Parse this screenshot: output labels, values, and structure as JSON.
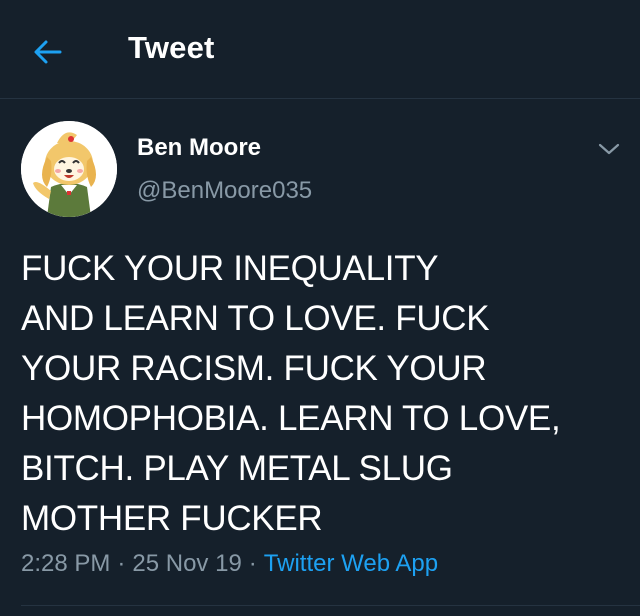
{
  "header": {
    "back_icon": "arrow-left-icon",
    "title": "Tweet"
  },
  "author": {
    "avatar_icon": "avatar-isabelle",
    "name": "Ben Moore",
    "handle": "@BenMoore035"
  },
  "tweet": {
    "lines": [
      "FUCK YOUR INEQUALITY",
      "AND LEARN TO LOVE. FUCK",
      "YOUR RACISM. FUCK YOUR",
      "HOMOPHOBIA. LEARN TO LOVE,",
      "BITCH. PLAY METAL SLUG",
      "MOTHER FUCKER"
    ]
  },
  "meta": {
    "time": "2:28 PM",
    "separator": "·",
    "date": "25 Nov 19",
    "source": "Twitter Web App"
  },
  "caret_icon": "chevron-down-icon",
  "colors": {
    "background": "#15202b",
    "text": "#ffffff",
    "secondary": "#8899a6",
    "accent": "#1da1f2",
    "divider": "#253341"
  }
}
